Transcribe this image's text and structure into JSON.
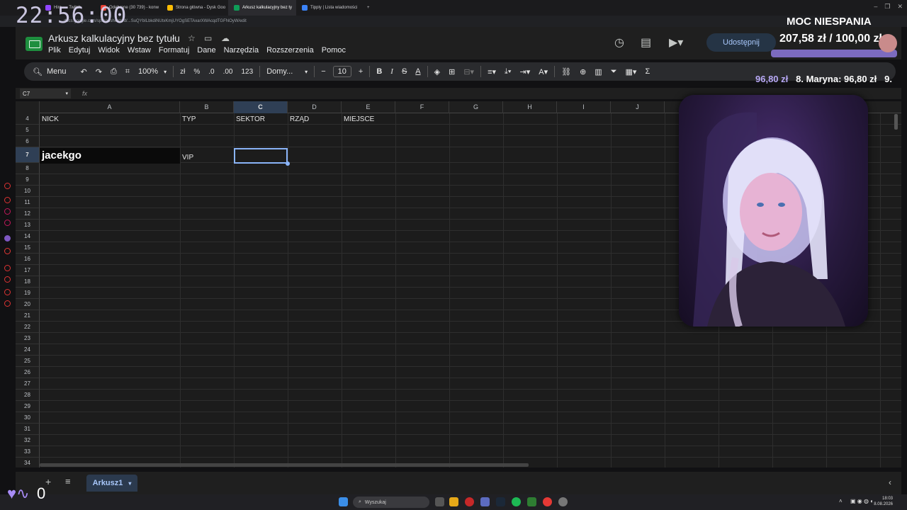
{
  "browser": {
    "tabs": [
      {
        "label": "Hira... - Twitch",
        "color": "#9146ff",
        "active": false
      },
      {
        "label": "Odebrane (30 739) - konw",
        "color": "#ea4335",
        "active": false
      },
      {
        "label": "Strona główna - Dysk Goo",
        "color": "#fbbc04",
        "active": false
      },
      {
        "label": "Arkusz kalkulacyjny bez ty",
        "color": "#0f9d58",
        "active": true
      },
      {
        "label": "Tipply | Lista wiadomości",
        "color": "#3b82f6",
        "active": false
      }
    ],
    "new_tab": "+",
    "url": "docs.google.com/spreadsheets/d/...SuQYbILbkdiNUtxKmjUYOgSETAxarXWAcqdTGFNOyW/edit"
  },
  "stream_clock": "22:56:00",
  "sheets": {
    "title": "Arkusz kalkulacyjny bez tytułu",
    "menu": [
      "Plik",
      "Edytuj",
      "Widok",
      "Wstaw",
      "Formatuj",
      "Dane",
      "Narzędzia",
      "Rozszerzenia",
      "Pomoc"
    ],
    "share_label": "Udostępnij",
    "toolbar": {
      "menu_label": "Menu",
      "zoom": "100%",
      "currency": "zł",
      "percent": "%",
      "dec_less": ".0",
      "dec_more": ".00",
      "number_format": "123",
      "font": "Domy...",
      "font_size": "10",
      "sum": "Σ"
    },
    "name_box": "C7",
    "fx": "fx",
    "columns": [
      "A",
      "B",
      "C",
      "D",
      "E",
      "F",
      "G",
      "H",
      "I",
      "J"
    ],
    "selected_column": "C",
    "rows": [
      4,
      5,
      6,
      7,
      8,
      9,
      10,
      11,
      12,
      13,
      14,
      15,
      16,
      17,
      18,
      19,
      20,
      21,
      22,
      23,
      24,
      25,
      26,
      27,
      28,
      29,
      30,
      31,
      32,
      33,
      34
    ],
    "selected_row": 7,
    "headers_row": {
      "a": "NICK",
      "b": "TYP",
      "c": "SEKTOR",
      "d": "RZĄD",
      "e": "MIEJSCE"
    },
    "row7": {
      "a": "jacekgo",
      "b": "VIP"
    },
    "sheet_tab": "Arkusz1"
  },
  "overlay": {
    "moc_title": "MOC NIESPANIA",
    "moc_value": "207,58 zł / 100,00 zł",
    "ticker_a": "96,80 zł",
    "ticker_b": "8. Maryna: 96,80 zł",
    "ticker_c": "9.",
    "heart_count": "0"
  },
  "taskbar": {
    "search": "Wyszukaj",
    "time": "18:03",
    "date": "8.08.2026"
  }
}
